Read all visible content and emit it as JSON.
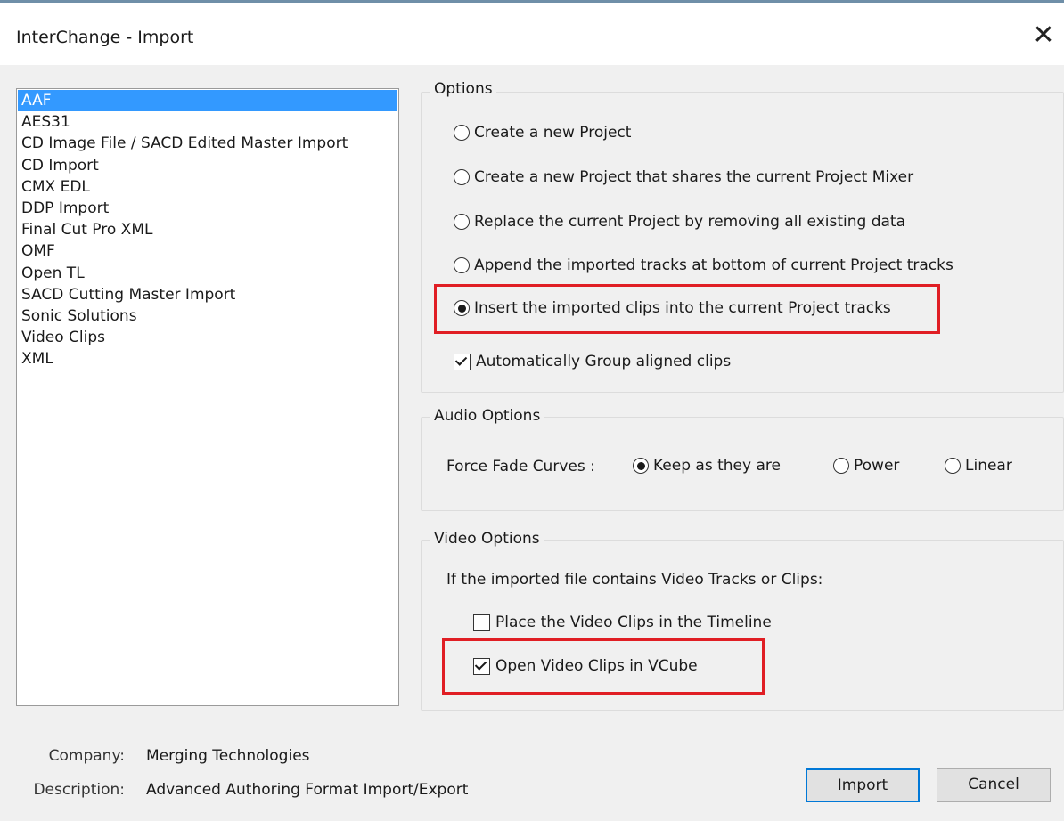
{
  "window": {
    "title": "InterChange - Import",
    "close_symbol": "✕"
  },
  "formats": {
    "items": [
      "AAF",
      "AES31",
      "CD Image File / SACD Edited Master Import",
      "CD Import",
      "CMX EDL",
      "DDP Import",
      "Final Cut Pro XML",
      "OMF",
      "Open TL",
      "SACD Cutting Master Import",
      "Sonic Solutions",
      "Video Clips",
      "XML"
    ],
    "selected": "AAF"
  },
  "options": {
    "label": "Options",
    "radios": [
      {
        "label": "Create a new Project",
        "checked": false
      },
      {
        "label": "Create a new Project that shares the current Project  Mixer",
        "checked": false
      },
      {
        "label": "Replace the current Project by removing all existing data",
        "checked": false
      },
      {
        "label": "Append the imported tracks at bottom of current Project tracks",
        "checked": false
      },
      {
        "label": "Insert the imported clips into the current Project tracks",
        "checked": true
      }
    ],
    "group_clips": {
      "label": "Automatically Group aligned clips",
      "checked": true
    }
  },
  "audio_options": {
    "label": "Audio Options",
    "fade_label": "Force Fade Curves :",
    "fade_choices": [
      {
        "label": "Keep as they are",
        "checked": true
      },
      {
        "label": "Power",
        "checked": false
      },
      {
        "label": "Linear",
        "checked": false
      }
    ]
  },
  "video_options": {
    "label": "Video Options",
    "intro": "If the imported file contains Video Tracks or Clips:",
    "place_in_timeline": {
      "label": "Place the Video Clips in the Timeline",
      "checked": false
    },
    "open_in_vcube": {
      "label": "Open Video Clips in VCube",
      "checked": true
    }
  },
  "info": {
    "company_label": "Company:",
    "company_value": "Merging Technologies",
    "description_label": "Description:",
    "description_value": "Advanced Authoring Format Import/Export"
  },
  "buttons": {
    "import": "Import",
    "cancel": "Cancel"
  },
  "colors": {
    "selection": "#3399ff",
    "highlight": "#e01e24",
    "default_button_border": "#0078d7"
  }
}
